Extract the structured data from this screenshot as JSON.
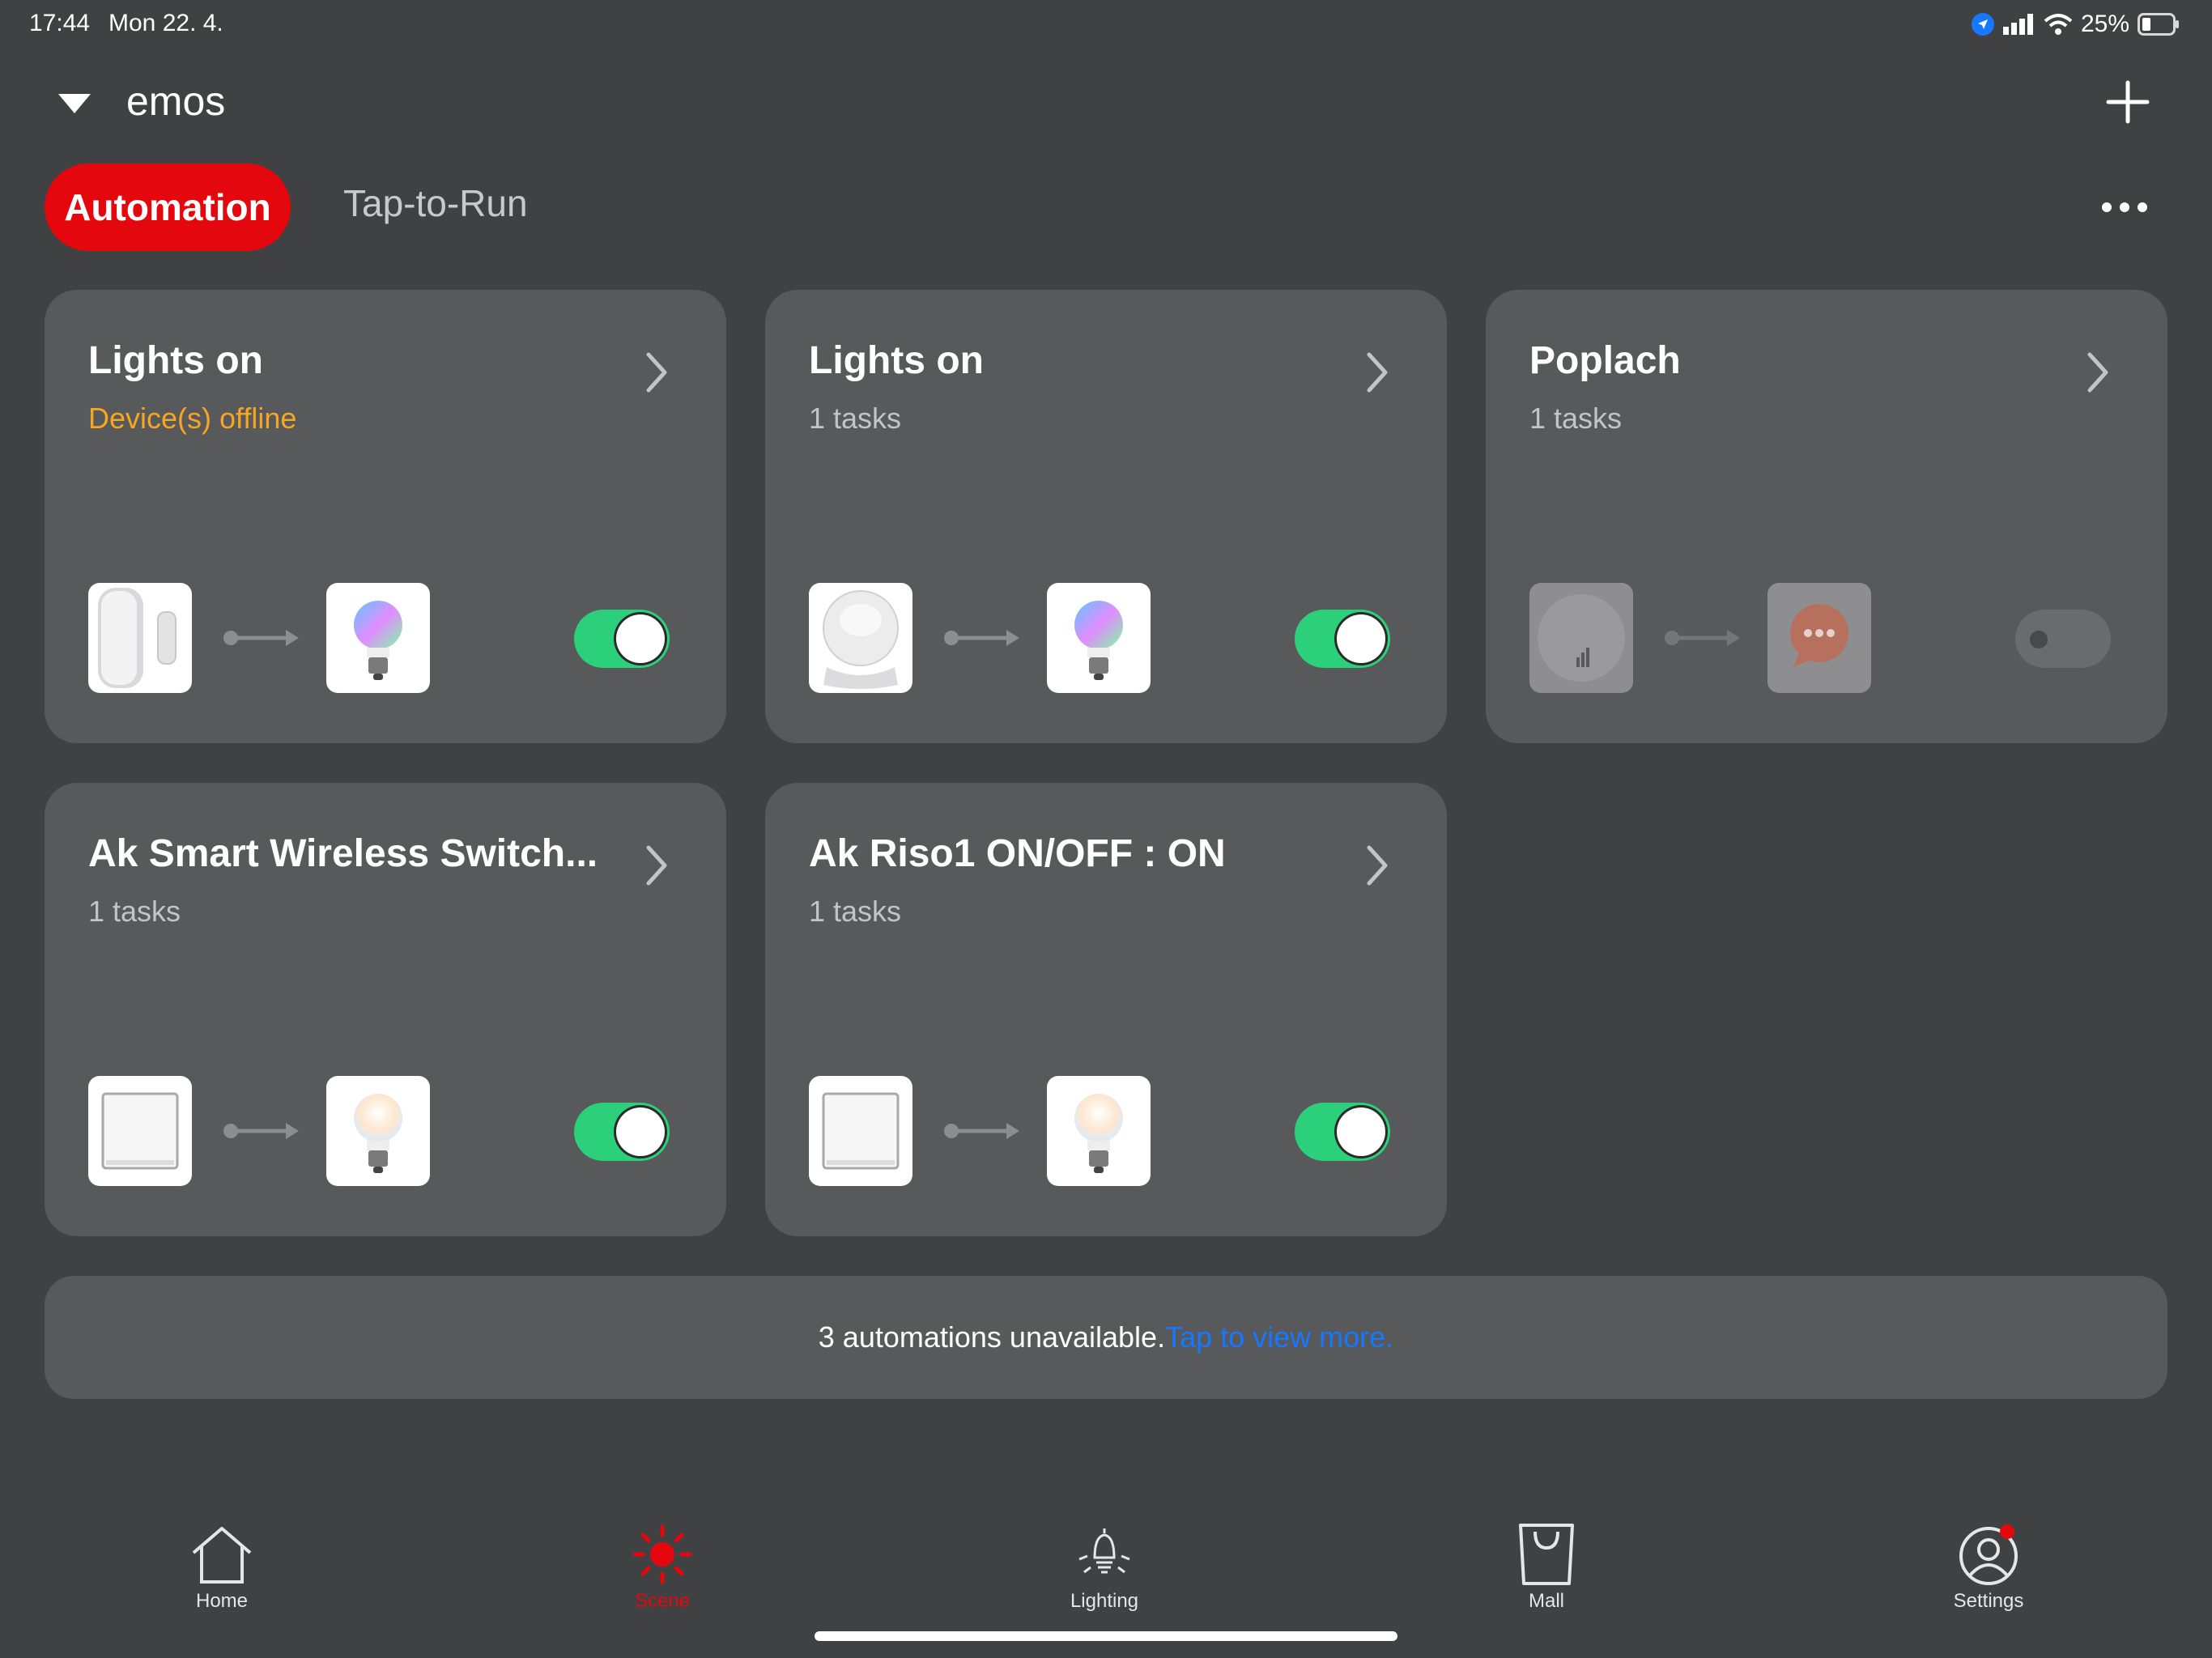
{
  "status_bar": {
    "time": "17:44",
    "date": "Mon 22. 4.",
    "battery": "25%"
  },
  "header": {
    "home_name": "emos"
  },
  "tabs": {
    "automation": "Automation",
    "tap_to_run": "Tap-to-Run"
  },
  "cards": [
    {
      "title": "Lights on",
      "subtitle": "Device(s) offline",
      "enabled": true,
      "left_icon": "door-sensor-icon",
      "right_icon": "rgb-bulb-icon"
    },
    {
      "title": "Lights on",
      "subtitle": "1 tasks",
      "enabled": true,
      "left_icon": "motion-sensor-icon",
      "right_icon": "rgb-bulb-icon"
    },
    {
      "title": "Poplach",
      "subtitle": "1 tasks",
      "enabled": false,
      "left_icon": "smart-plug-icon",
      "right_icon": "message-icon"
    },
    {
      "title": "Ak Smart Wireless Switch...",
      "subtitle": "1 tasks",
      "enabled": true,
      "left_icon": "wall-switch-icon",
      "right_icon": "warm-bulb-icon"
    },
    {
      "title": "Ak Riso1 ON/OFF : ON",
      "subtitle": "1 tasks",
      "enabled": true,
      "left_icon": "wall-switch-icon",
      "right_icon": "warm-bulb-icon"
    }
  ],
  "banner": {
    "text": "3 automations unavailable.",
    "link": "Tap to view more."
  },
  "nav": {
    "home": "Home",
    "scene": "Scene",
    "lighting": "Lighting",
    "mall": "Mall",
    "settings": "Settings"
  },
  "colors": {
    "background": "#404143",
    "card": "#58595b",
    "accent": "#e5070e",
    "toggle_on": "#2dd07a",
    "warning": "#f5a623",
    "link": "#1677ff"
  }
}
